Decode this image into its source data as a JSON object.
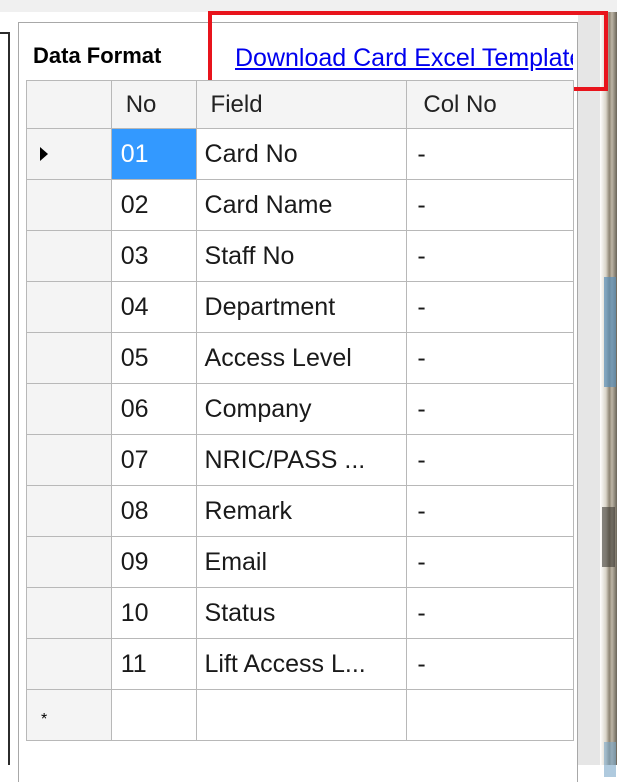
{
  "panel": {
    "group_title": "Data Format",
    "download_link": "Download Card Excel Template"
  },
  "grid": {
    "columns": [
      "No",
      "Field",
      "Col No"
    ],
    "rows": [
      {
        "no": "01",
        "field": "Card No",
        "col": "-"
      },
      {
        "no": "02",
        "field": "Card Name",
        "col": "-"
      },
      {
        "no": "03",
        "field": "Staff No",
        "col": "-"
      },
      {
        "no": "04",
        "field": "Department",
        "col": "-"
      },
      {
        "no": "05",
        "field": "Access Level",
        "col": "-"
      },
      {
        "no": "06",
        "field": "Company",
        "col": "-"
      },
      {
        "no": "07",
        "field": "NRIC/PASS ...",
        "col": "-"
      },
      {
        "no": "08",
        "field": "Remark",
        "col": "-"
      },
      {
        "no": "09",
        "field": "Email",
        "col": "-"
      },
      {
        "no": "10",
        "field": "Status",
        "col": "-"
      },
      {
        "no": "11",
        "field": "Lift Access L...",
        "col": "-"
      }
    ],
    "new_row_marker": "*",
    "selected_row_index": 0
  },
  "colors": {
    "highlight": "#e8141c",
    "link": "#0000ee",
    "selection": "#3399ff"
  }
}
